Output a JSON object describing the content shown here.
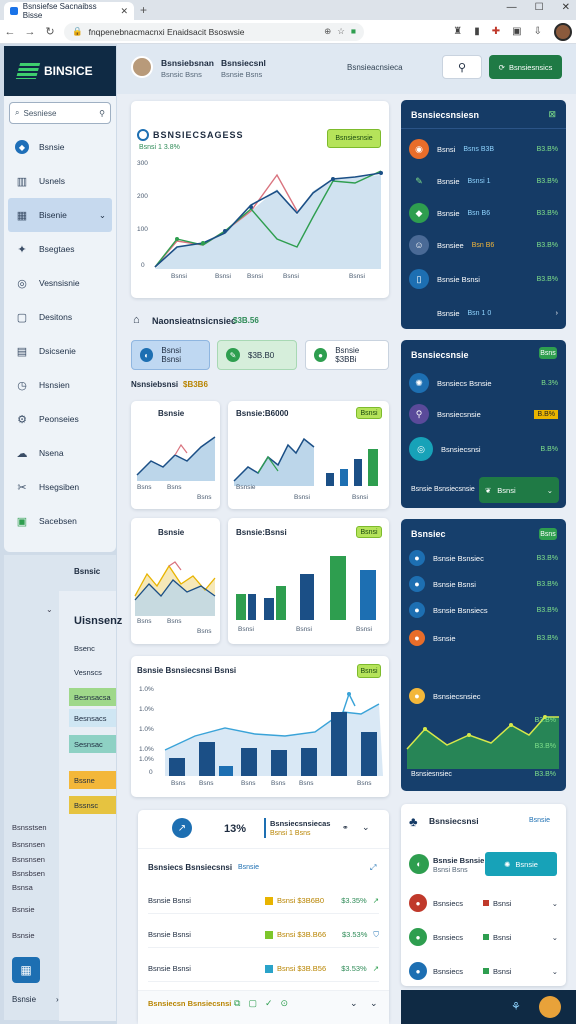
{
  "browser": {
    "tab_title": "Bsnsiefse Sacnaibss Bisse",
    "url": "fnqpenebnacmacnxi Enaidsacit Bsoswsie",
    "controls": [
      "—",
      "☐",
      "✕"
    ]
  },
  "brand": {
    "name": "BINSICE"
  },
  "sidebar": {
    "search_placeholder": "Sesniese",
    "items": [
      {
        "label": "Bsnsie",
        "icon": "dashboard-icon"
      },
      {
        "label": "Usnels",
        "icon": "chart-icon"
      },
      {
        "label": "Bisenie",
        "icon": "table-icon"
      },
      {
        "label": "Bsegtaes",
        "icon": "tag-icon"
      },
      {
        "label": "Vesnsisnie",
        "icon": "target-icon"
      },
      {
        "label": "Desitons",
        "icon": "file-icon"
      },
      {
        "label": "Dsicsenie",
        "icon": "calendar-icon"
      },
      {
        "label": "Hsnsien",
        "icon": "clock-icon"
      },
      {
        "label": "Peonseies",
        "icon": "settings-icon"
      },
      {
        "label": "Nsena",
        "icon": "cloud-icon"
      },
      {
        "label": "Hsegsiben",
        "icon": "tools-icon"
      },
      {
        "label": "Sacebsen",
        "icon": "inbox-icon"
      }
    ],
    "lower_title": "Bsnsic",
    "lower_header": "Uisnsenz",
    "lower_rows": [
      "Bsenc",
      "Vesnscs",
      "Besnsacsa",
      "Besnsacs",
      "Sesnsac",
      "Bssne",
      "Bssnsc"
    ],
    "lower_left": [
      "Bsnsstsen",
      "Bsnsnsen",
      "Bsnsnsen",
      "Bsnsbsen",
      "Bsnsa",
      "Bsnsie",
      "Bsnsie",
      "Besnsnsi",
      "Bsnsns",
      "Besnsion",
      "Aiosns"
    ],
    "lower_footer_label": "Bsnsie",
    "lower_footer_arrow": "›"
  },
  "header": {
    "user_name": "Bsnsiebsnan",
    "user_sub": "Bsnsic Bsns",
    "user2_name": "Bsnsiecsnl",
    "user2_sub": "Bsnsie Bsns",
    "middle": "Bsnsieacnsieca",
    "search_icon": "search-icon",
    "action_label": "Bsnsiesnsics"
  },
  "main_chart": {
    "title": "BSNSIECSAGESS",
    "subtitle": "Bsnsi 1 3.8%",
    "button": "Bsnsiesnsie",
    "xlabels": [
      "Bsnsi",
      "Bsnsi",
      "Bsnsi",
      "Bsnsi",
      "Bsnsi"
    ],
    "ylabels": [
      "300",
      "200",
      "100",
      "0"
    ]
  },
  "section": {
    "title": "Naonsieatnsicnsiec",
    "value": "$3B.56",
    "pills": [
      "Bsnsi Bsnsi",
      "$3B.B0",
      "Bsnsie $3BBi"
    ],
    "sub_label": "Nsnsiebsnsi",
    "sub_value": "$B3B6"
  },
  "mini1": {
    "title": "Bsnsie",
    "x": [
      "Bsns",
      "Bsns",
      "Bsns"
    ]
  },
  "mini2": {
    "title": "Bsnsie:B6000",
    "badge": "Bsnsi",
    "x": [
      "Bsnsie",
      "Bsnsi",
      "Bsnsi"
    ]
  },
  "mini3": {
    "title": "Bsnsie",
    "x": [
      "Bsns",
      "Bsns",
      "Bsns"
    ]
  },
  "mini4": {
    "title": "Bsnsie:Bsnsi",
    "badge": "Bsnsi",
    "x": [
      "Bsnsi",
      "Bsnsi",
      "Bsnsi"
    ]
  },
  "combo": {
    "title": "Bsnsie Bsnsiecsnsi Bsnsi",
    "badge": "Bsnsi",
    "ylabels": [
      "1.0%",
      "1.0%",
      "1.0%",
      "1.0%",
      "1.0%",
      "0"
    ],
    "x": [
      "Bsns",
      "Bsns",
      "Bsns",
      "Bsns",
      "Bsns",
      "Bsns"
    ]
  },
  "bottom": {
    "value": "13%",
    "label": "Bsnsiecsnsiecas",
    "sub": "Bsnsi 1 Bsns",
    "table_title": "Bsnsiecs Bsnsiecsnsi",
    "table_link": "Bsnsie",
    "rows": [
      {
        "name": "Bsnsie Bsnsi",
        "code": "Bsnsi $3B6B0",
        "pct": "$3.35%",
        "color": "#e8b400"
      },
      {
        "name": "Bsnsie Bsnsi",
        "code": "Bsnsi $3B.B66",
        "pct": "$3.53%",
        "color": "#7dc62b"
      },
      {
        "name": "Bsnsie Bsnsi",
        "code": "Bsnsi $3B.B56",
        "pct": "$3.53%",
        "color": "#2aa3c9"
      }
    ],
    "footer": "Bsnsiecsn Bsnsiecsnsi"
  },
  "right1": {
    "title": "Bsnsiecsnsiesn",
    "rows": [
      {
        "label": "Bsnsi",
        "mid": "Bsns B3B",
        "val": "B3.B%"
      },
      {
        "label": "Bsnsie",
        "mid": "Bsnsi 1",
        "val": "B3.B%"
      },
      {
        "label": "Bsnsie",
        "mid": "Bsn B6",
        "val": "B3.B%"
      },
      {
        "label": "Bsnsiee",
        "mid": "Bsn B6",
        "val": "B3.B%"
      },
      {
        "label": "Bsnsie Bsnsi",
        "mid": "",
        "val": "B3.B%"
      },
      {
        "label": "Bsnsie",
        "mid": "Bsn 1 0",
        "val": "›"
      }
    ]
  },
  "right2": {
    "title": "Bsnsiecsnsie",
    "badge": "Bsns",
    "rows": [
      {
        "label": "Bsnsiecs Bsnsie",
        "val": "B.3%"
      },
      {
        "label": "Bsnsiecsnsie",
        "val": "B.B%"
      },
      {
        "label": "Bsnsiecsnsi",
        "val": "B.B%"
      }
    ],
    "footer": "Bsnsie Bsnsiecsnsie",
    "footer_btn": "Bsnsi"
  },
  "right3": {
    "title": "Bsnsiec",
    "badge": "Bsns",
    "rows": [
      {
        "label": "Bsnsie Bsnsiec",
        "val": "B3.B%"
      },
      {
        "label": "Bsnsie Bsnsi",
        "val": "B3.B%"
      },
      {
        "label": "Bsnsie Bsnsiecs",
        "val": "B3.B%"
      },
      {
        "label": "Bsnsie",
        "val": "B3.B%"
      },
      {
        "label": "Bsnsiecsnsiec",
        "val": ""
      }
    ],
    "chart_x_label": "Bsnsiesnsiec",
    "chart_vals": [
      "B3.B%",
      "B3.B%",
      "B3.B%"
    ]
  },
  "right4": {
    "title": "Bsnsiecsnsi",
    "link": "Bsnsie",
    "user": "Bsnsie Bsnsie",
    "user_sub": "Bsnsi Bsns",
    "button": "Bsnsie",
    "rows": [
      {
        "label": "Bsnsiecs",
        "tag": "Bsnsi"
      },
      {
        "label": "Bsnsiecs",
        "tag": "Bsnsi"
      },
      {
        "label": "Bsnsiecs",
        "tag": "Bsnsi"
      }
    ]
  },
  "colors": {
    "navy": "#153b66",
    "green": "#2e9e4f",
    "accent_blue": "#1d6fb2",
    "lime": "#b5e35a"
  }
}
